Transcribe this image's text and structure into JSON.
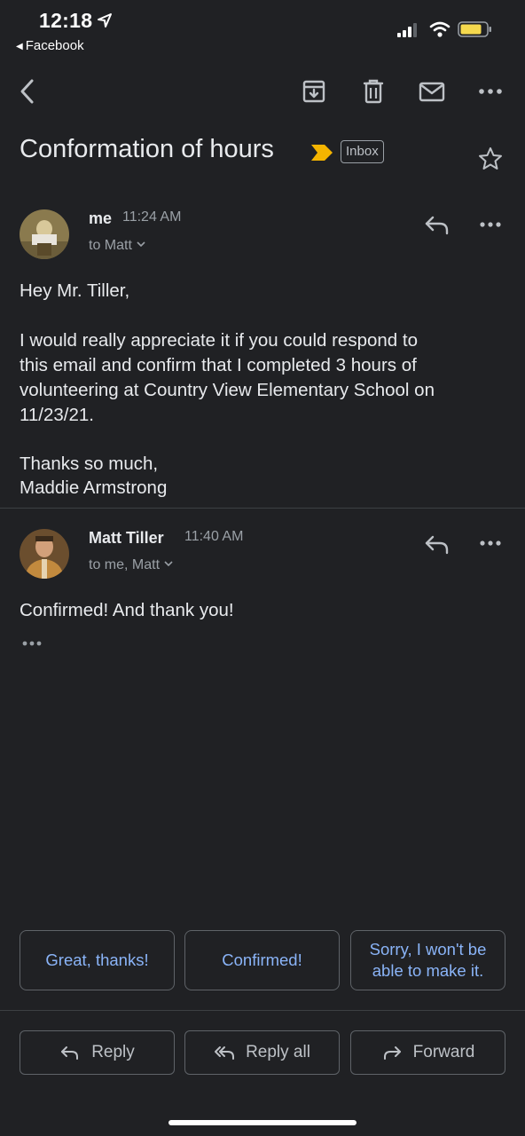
{
  "status_bar": {
    "time": "12:18",
    "back_app_label": "Facebook",
    "battery_color": "#f5d94e"
  },
  "toolbar": {
    "icons": [
      "back-arrow-icon",
      "archive-icon",
      "delete-icon",
      "mark-unread-icon",
      "more-icon"
    ]
  },
  "email": {
    "subject": "Conformation of hours",
    "label_chip": "Inbox",
    "importance_color": "#f4b400"
  },
  "messages": [
    {
      "sender": "me",
      "time": "11:24 AM",
      "recipients": "to Matt",
      "body": [
        "Hey Mr. Tiller,",
        "I would really appreciate it if you could respond to",
        "this email and confirm that I completed 3 hours of",
        "volunteering at Country View Elementary School on",
        "11/23/21.",
        "Thanks so much,",
        "Maddie Armstrong"
      ]
    },
    {
      "sender": "Matt Tiller",
      "time": "11:40 AM",
      "recipients": "to me, Matt",
      "body": [
        "Confirmed! And thank you!"
      ]
    }
  ],
  "smart_replies": [
    "Great, thanks!",
    "Confirmed!",
    "Sorry, I won't be able to make it."
  ],
  "actions": {
    "reply": "Reply",
    "reply_all": "Reply all",
    "forward": "Forward"
  },
  "colors": {
    "background": "#202124",
    "accent_blue": "#8ab4f8",
    "text_primary": "#e8eaed",
    "text_secondary": "#9aa0a6"
  }
}
